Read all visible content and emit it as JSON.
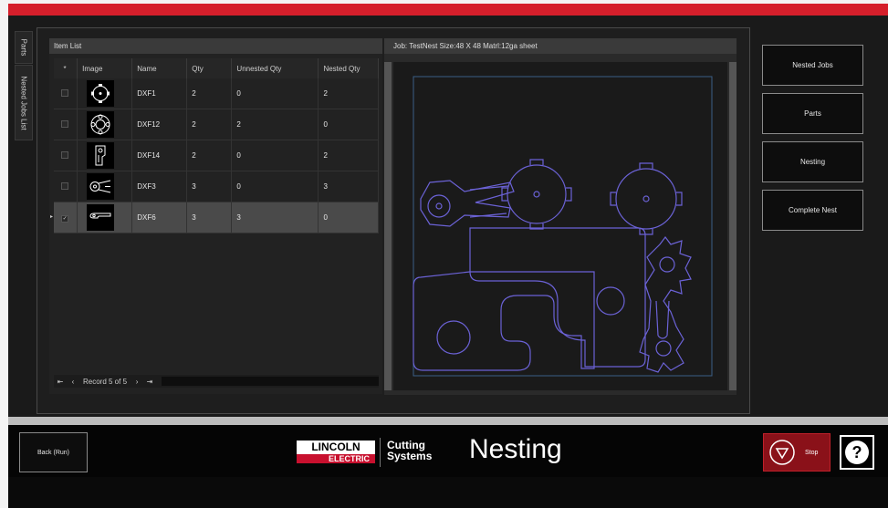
{
  "tabs": {
    "parts": "Parts",
    "nested_jobs": "Nested Jobs List"
  },
  "item_list": {
    "title": "Item List",
    "columns": [
      "*",
      "Image",
      "Name",
      "Qty",
      "Unnested Qty",
      "Nested Qty"
    ],
    "rows": [
      {
        "name": "DXF1",
        "qty": "2",
        "unnested": "0",
        "nested": "2",
        "checked": "",
        "image": "dxf1-thumbnail"
      },
      {
        "name": "DXF12",
        "qty": "2",
        "unnested": "2",
        "nested": "0",
        "checked": "",
        "image": "dxf12-thumbnail"
      },
      {
        "name": "DXF14",
        "qty": "2",
        "unnested": "0",
        "nested": "2",
        "checked": "",
        "image": "dxf14-thumbnail"
      },
      {
        "name": "DXF3",
        "qty": "3",
        "unnested": "0",
        "nested": "3",
        "checked": "",
        "image": "dxf3-thumbnail"
      },
      {
        "name": "DXF6",
        "qty": "3",
        "unnested": "3",
        "nested": "0",
        "checked": "✓",
        "image": "dxf6-thumbnail"
      }
    ],
    "pager": {
      "first": "⇤",
      "prev": "‹",
      "record": "Record 5 of 5",
      "next": "›",
      "last": "⇥"
    }
  },
  "nest_view": {
    "header": "Job: TestNest   Size:48 X 48   Matrl:12ga sheet"
  },
  "side_buttons": [
    "Nested Jobs",
    "Parts",
    "Nesting",
    "Complete Nest"
  ],
  "footer": {
    "back_label": "Back (Run)",
    "brand_top": "LINCOLN",
    "brand_bottom": "ELECTRIC",
    "brand_product_1": "Cutting",
    "brand_product_2": "Systems",
    "screen_title": "Nesting",
    "stop_label": "Stop",
    "help_label": "?"
  },
  "colors": {
    "accent_red": "#d51f2b",
    "part_outline": "#6b62d6",
    "sheet_outline": "#3b5f86"
  }
}
